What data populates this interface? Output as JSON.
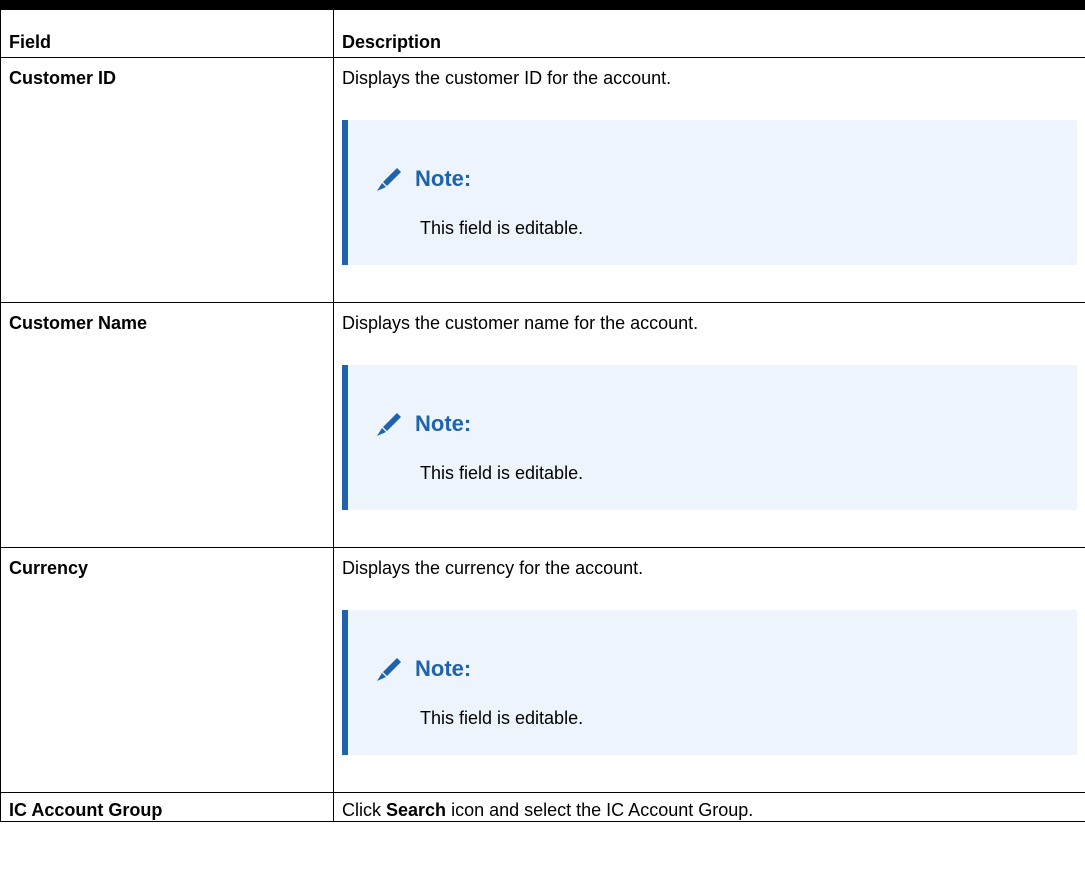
{
  "table": {
    "headers": {
      "field": "Field",
      "description": "Description"
    },
    "rows": [
      {
        "field": "Customer ID",
        "description": "Displays the customer ID for the account.",
        "note_title": "Note:",
        "note_text": "This field is editable."
      },
      {
        "field": "Customer Name",
        "description": "Displays the customer name for the account.",
        "note_title": "Note:",
        "note_text": "This field is editable."
      },
      {
        "field": "Currency",
        "description": "Displays the currency for the account.",
        "note_title": "Note:",
        "note_text": "This field is editable."
      },
      {
        "field": "IC Account Group",
        "description_prefix": "Click",
        "description_strong": "Search",
        "description_suffix": "icon and select the IC Account Group."
      }
    ]
  },
  "icons": {
    "note_icon": "pencil-icon"
  },
  "colors": {
    "note_accent": "#1f63ad",
    "note_background": "#eef4fb",
    "border": "#000000"
  }
}
